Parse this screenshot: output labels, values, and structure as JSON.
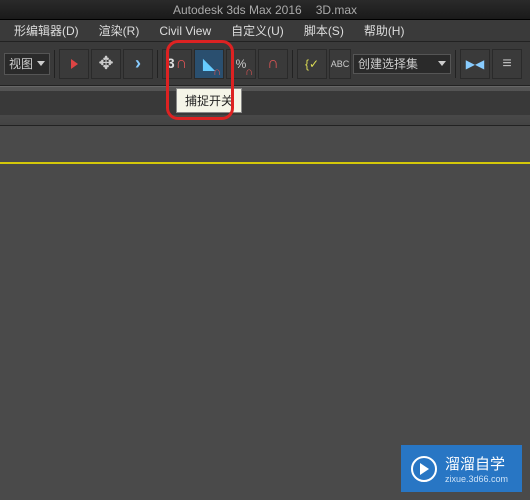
{
  "title": {
    "app": "Autodesk 3ds Max 2016",
    "file": "3D.max"
  },
  "menu": {
    "editor": "形编辑器(D)",
    "render": "渲染(R)",
    "civil": "Civil View",
    "custom": "自定义(U)",
    "script": "脚本(S)",
    "help": "帮助(H)"
  },
  "toolbar": {
    "view_dropdown": "视图",
    "snap_number": "3",
    "abc_label": "ABC",
    "selection_set_placeholder": "创建选择集"
  },
  "tooltip": {
    "snap_toggle": "捕捉开关"
  },
  "watermark": {
    "brand": "溜溜自学",
    "url": "zixue.3d66.com"
  }
}
